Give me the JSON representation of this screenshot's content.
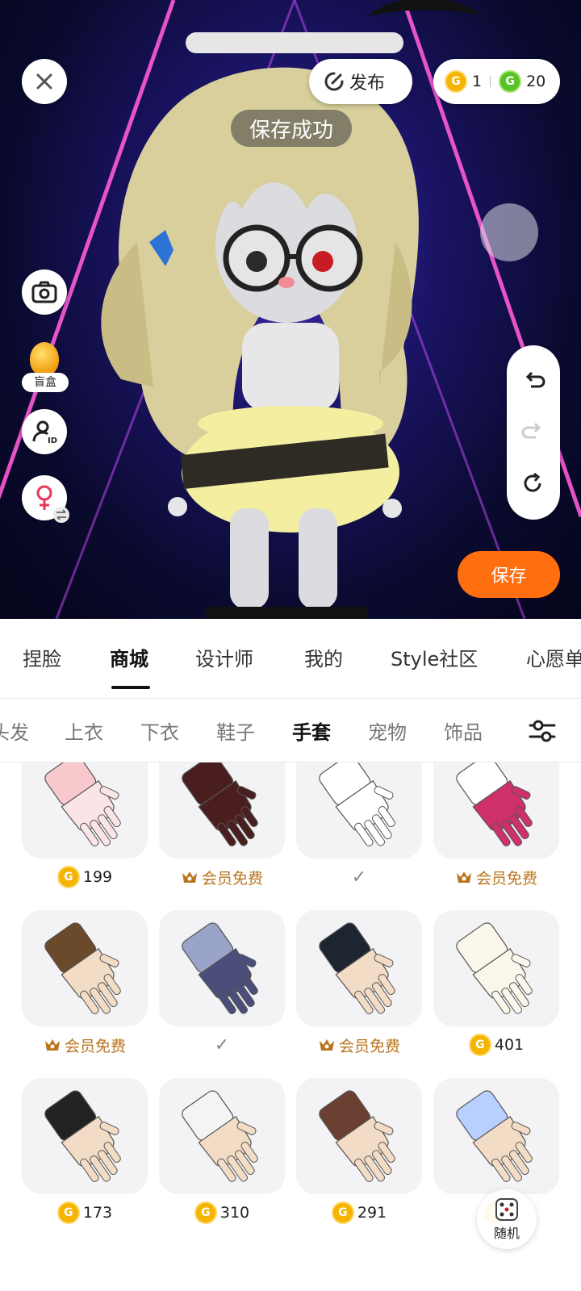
{
  "header": {
    "publish_label": "发布",
    "gold_coins": "1",
    "green_coins": "20",
    "toast": "保存成功"
  },
  "left_tools": {
    "blindbox_label": "盲盒"
  },
  "save_label": "保存",
  "main_tabs": [
    {
      "label": "捏脸",
      "active": false
    },
    {
      "label": "商城",
      "active": true
    },
    {
      "label": "设计师",
      "active": false
    },
    {
      "label": "我的",
      "active": false
    },
    {
      "label": "Style社区",
      "active": false
    },
    {
      "label": "心愿单",
      "active": false
    }
  ],
  "sub_tabs": [
    {
      "label": "头发",
      "active": false
    },
    {
      "label": "上衣",
      "active": false
    },
    {
      "label": "下衣",
      "active": false
    },
    {
      "label": "鞋子",
      "active": false
    },
    {
      "label": "手套",
      "active": true
    },
    {
      "label": "宠物",
      "active": false
    },
    {
      "label": "饰品",
      "active": false
    }
  ],
  "items": [
    {
      "kind": "coin",
      "price": "199",
      "icon": "pink-paw-glove-icon"
    },
    {
      "kind": "vip",
      "price": "会员免费",
      "icon": "dark-red-glove-icon"
    },
    {
      "kind": "owned",
      "price": "✓",
      "icon": "white-glove-icon"
    },
    {
      "kind": "vip",
      "price": "会员免费",
      "icon": "white-bow-glove-icon"
    },
    {
      "kind": "vip",
      "price": "会员免费",
      "icon": "brown-fingerless-glove-icon"
    },
    {
      "kind": "owned",
      "price": "✓",
      "icon": "shark-puppet-glove-icon"
    },
    {
      "kind": "vip",
      "price": "会员免费",
      "icon": "black-paw-glove-icon"
    },
    {
      "kind": "coin",
      "price": "401",
      "icon": "cream-glove-icon"
    },
    {
      "kind": "coin",
      "price": "173",
      "icon": "black-bow-glove-icon"
    },
    {
      "kind": "coin",
      "price": "310",
      "icon": "white-lace-glove-icon"
    },
    {
      "kind": "coin",
      "price": "291",
      "icon": "brown-fingerless-glove-icon-2"
    },
    {
      "kind": "coin",
      "price": "",
      "icon": "blue-glove-icon"
    }
  ],
  "random_label": "随机",
  "colors": {
    "accent_orange": "#ff6f0f",
    "vip_gold": "#b8751e",
    "coin_gold": "#f4b400",
    "coin_green": "#59c12a"
  }
}
